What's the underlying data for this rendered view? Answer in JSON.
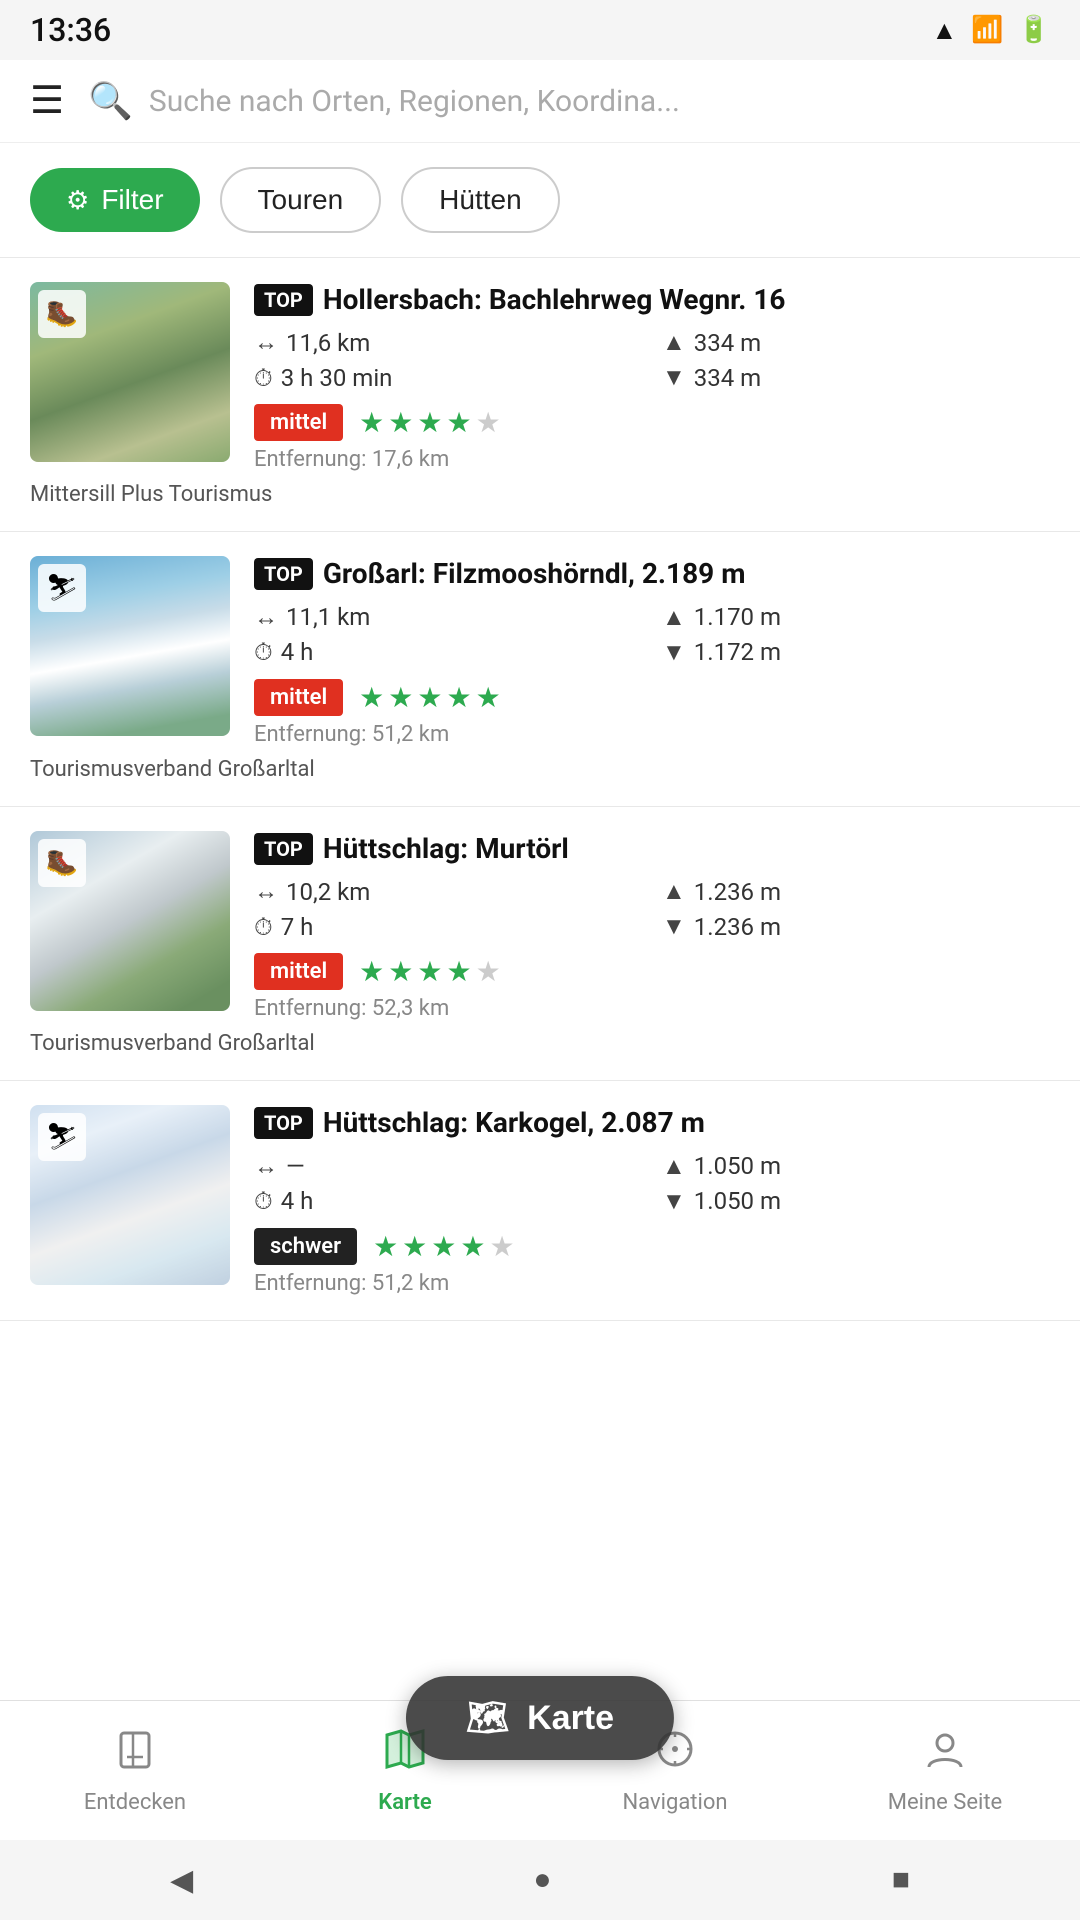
{
  "statusBar": {
    "time": "13:36",
    "icons": [
      "wifi",
      "signal",
      "battery"
    ]
  },
  "header": {
    "menuLabel": "☰",
    "searchPlaceholder": "Suche nach Orten, Regionen, Koordina..."
  },
  "filterBar": {
    "filterLabel": "Filter",
    "pills": [
      "Touren",
      "Hütten"
    ]
  },
  "tours": [
    {
      "id": 1,
      "badge": "TOP",
      "title": "Hollersbach: Bachlehrweg Wegnr. 16",
      "distance": "11,6 km",
      "elevation_up": "334 m",
      "duration": "3 h 30 min",
      "elevation_down": "334 m",
      "difficulty": "mittel",
      "difficulty_class": "mittel",
      "stars": 3.5,
      "stars_count": 5,
      "distance_label": "Entfernung: 17,6 km",
      "provider": "Mittersill Plus Tourismus",
      "img_class": "img-1",
      "category_icon": "🥾"
    },
    {
      "id": 2,
      "badge": "TOP",
      "title": "Großarl: Filzmooshörndl, 2.189 m",
      "distance": "11,1 km",
      "elevation_up": "1.170 m",
      "duration": "4 h",
      "elevation_down": "1.172 m",
      "difficulty": "mittel",
      "difficulty_class": "mittel",
      "stars": 5,
      "stars_count": 5,
      "distance_label": "Entfernung: 51,2 km",
      "provider": "Tourismusverband Großarltal",
      "img_class": "img-2",
      "category_icon": "⛷"
    },
    {
      "id": 3,
      "badge": "TOP",
      "title": "Hüttschlag: Murtörl",
      "distance": "10,2 km",
      "elevation_up": "1.236 m",
      "duration": "7 h",
      "elevation_down": "1.236 m",
      "difficulty": "mittel",
      "difficulty_class": "mittel",
      "stars": 4,
      "stars_count": 5,
      "distance_label": "Entfernung: 52,3 km",
      "provider": "Tourismusverband Großarltal",
      "img_class": "img-3",
      "category_icon": "🥾"
    },
    {
      "id": 4,
      "badge": "TOP",
      "title": "Hüttschlag: Karkogel, 2.087 m",
      "distance": "—",
      "elevation_up": "1.050 m",
      "duration": "4 h",
      "elevation_down": "1.050 m",
      "difficulty": "schwer",
      "difficulty_class": "schwer",
      "stars": 4,
      "stars_count": 5,
      "distance_label": "Entfernung: 51,2 km",
      "provider": "",
      "img_class": "img-4",
      "category_icon": "⛷"
    }
  ],
  "floatingButton": {
    "label": "Karte",
    "icon": "🗺"
  },
  "bottomNav": [
    {
      "id": "entdecken",
      "label": "Entdecken",
      "icon": "bookmark",
      "active": false
    },
    {
      "id": "karte",
      "label": "Karte",
      "icon": "map",
      "active": true
    },
    {
      "id": "navigation",
      "label": "Navigation",
      "icon": "navigation",
      "active": false
    },
    {
      "id": "meine-seite",
      "label": "Meine Seite",
      "icon": "person",
      "active": false
    }
  ],
  "androidNav": {
    "back": "◀",
    "home": "●",
    "recent": "■"
  }
}
